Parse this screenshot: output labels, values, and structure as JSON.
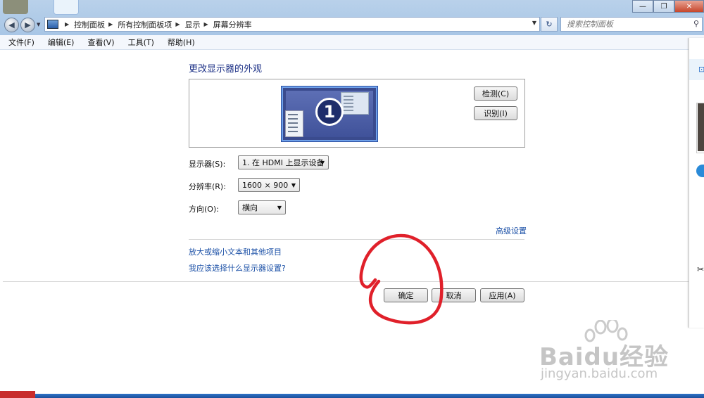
{
  "window": {
    "minimize": "—",
    "maximize": "❐",
    "close": "✕"
  },
  "address": {
    "crumbs": [
      "控制面板",
      "所有控制面板项",
      "显示",
      "屏幕分辨率"
    ],
    "search_placeholder": "搜索控制面板"
  },
  "menu": [
    "文件(F)",
    "编辑(E)",
    "查看(V)",
    "工具(T)",
    "帮助(H)"
  ],
  "main": {
    "heading": "更改显示器的外观",
    "monitor_number": "1",
    "detect_button": "检测(C)",
    "identify_button": "识别(I)",
    "display_label": "显示器(S):",
    "display_value": "1. 在 HDMI 上显示设备",
    "resolution_label": "分辨率(R):",
    "resolution_value": "1600 × 900",
    "orientation_label": "方向(O):",
    "orientation_value": "横向",
    "advanced_link": "高级设置",
    "link_text_size": "放大或缩小文本和其他项目",
    "link_which_settings": "我应该选择什么显示器设置?",
    "ok_button": "确定",
    "cancel_button": "取消",
    "apply_button": "应用(A)"
  },
  "watermark": {
    "brand": "Baidu经验",
    "url": "jingyan.baidu.com"
  },
  "colors": {
    "heading": "#1e3287",
    "link": "#1a4fa6",
    "annotation": "#e0202a",
    "titlebar": "#b9d1ea"
  }
}
